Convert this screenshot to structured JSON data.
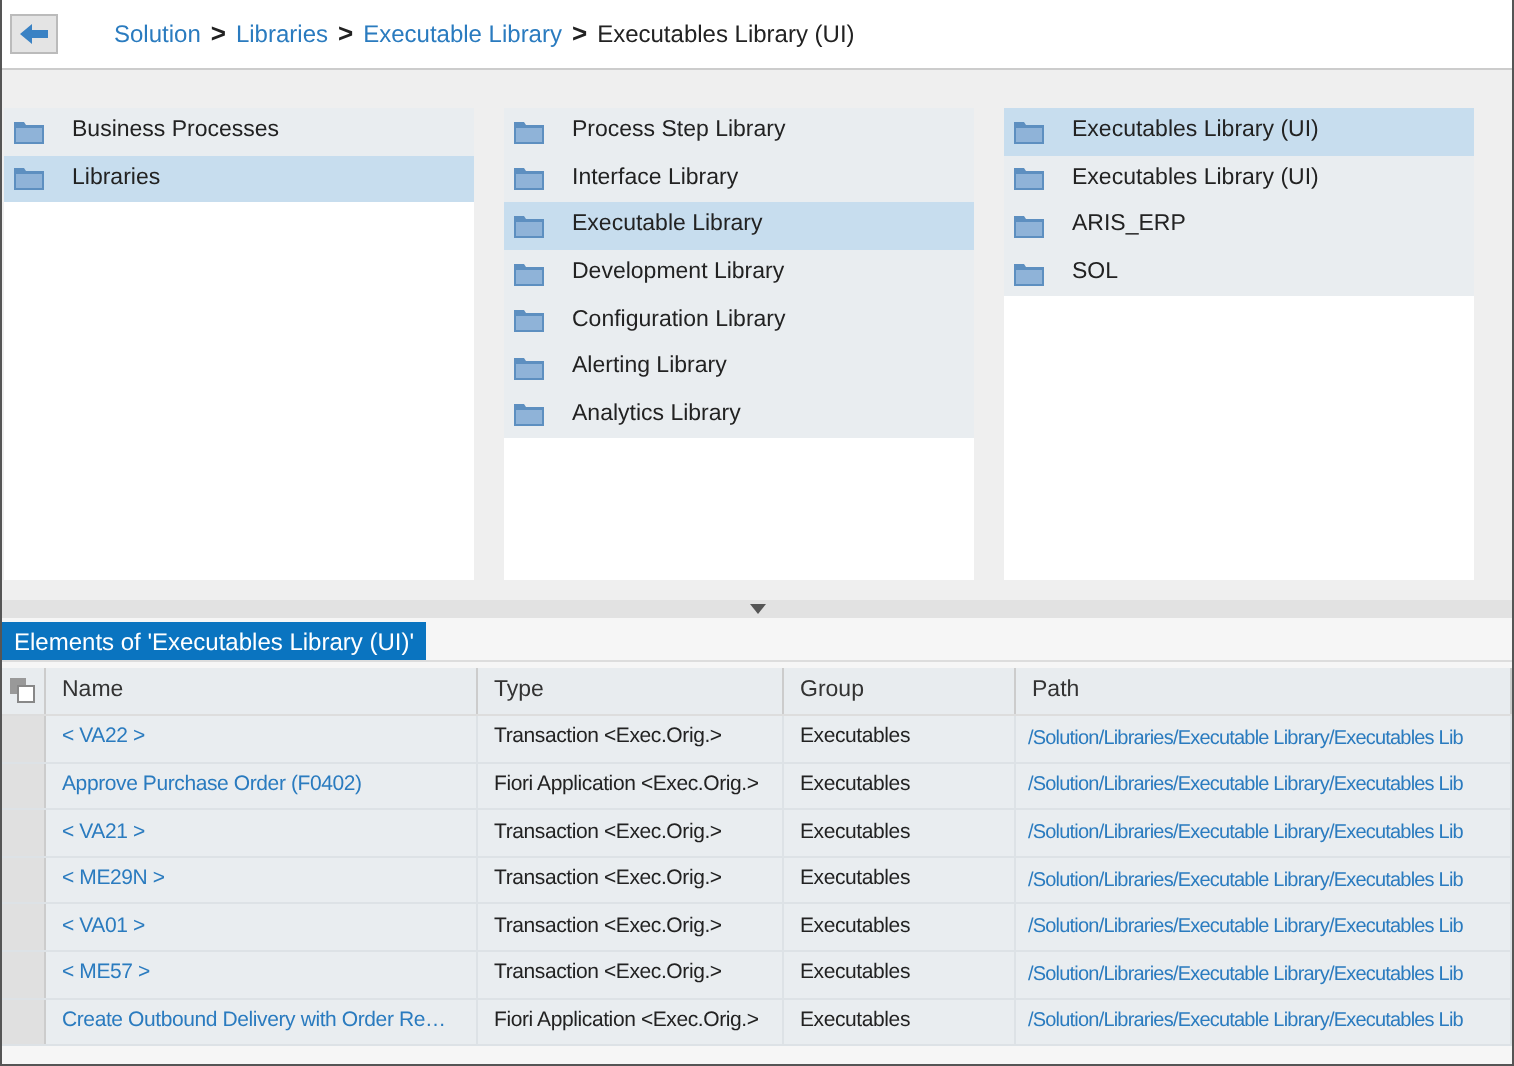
{
  "breadcrumb": [
    {
      "label": "Solution",
      "current": false
    },
    {
      "separator": ">",
      "label": "Libraries",
      "current": false
    },
    {
      "separator": ">",
      "label": "Executable Library",
      "current": false
    },
    {
      "separator": ">",
      "label": "Executables Library (UI)",
      "current": true
    }
  ],
  "panes": [
    {
      "items": [
        {
          "label": "Business Processes",
          "selected": false
        },
        {
          "label": "Libraries",
          "selected": true
        }
      ]
    },
    {
      "items": [
        {
          "label": "Process Step Library",
          "selected": false
        },
        {
          "label": "Interface Library",
          "selected": false
        },
        {
          "label": "Executable Library",
          "selected": true
        },
        {
          "label": "Development Library",
          "selected": false
        },
        {
          "label": "Configuration Library",
          "selected": false
        },
        {
          "label": "Alerting Library",
          "selected": false
        },
        {
          "label": "Analytics Library",
          "selected": false
        }
      ]
    },
    {
      "items": [
        {
          "label": "Executables Library (UI)",
          "selected": true
        },
        {
          "label": "Executables Library (UI)",
          "selected": false
        },
        {
          "label": "ARIS_ERP",
          "selected": false
        },
        {
          "label": "SOL",
          "selected": false
        }
      ]
    }
  ],
  "table": {
    "tab": "Elements of 'Executables Library (UI)'",
    "columns": [
      "Name",
      "Type",
      "Group",
      "Path"
    ],
    "rows": [
      [
        "< VA22 >",
        "Transaction <Exec.Orig.>",
        "Executables",
        "/Solution/Libraries/Executable Library/Executables Lib"
      ],
      [
        "Approve Purchase Order (F0402)",
        "Fiori Application <Exec.Orig.>",
        "Executables",
        "/Solution/Libraries/Executable Library/Executables Lib"
      ],
      [
        "< VA21 >",
        "Transaction <Exec.Orig.>",
        "Executables",
        "/Solution/Libraries/Executable Library/Executables Lib"
      ],
      [
        "< ME29N >",
        "Transaction <Exec.Orig.>",
        "Executables",
        "/Solution/Libraries/Executable Library/Executables Lib"
      ],
      [
        "< VA01 >",
        "Transaction <Exec.Orig.>",
        "Executables",
        "/Solution/Libraries/Executable Library/Executables Lib"
      ],
      [
        "< ME57 >",
        "Transaction <Exec.Orig.>",
        "Executables",
        "/Solution/Libraries/Executable Library/Executables Lib"
      ],
      [
        "Create Outbound Delivery with Order Re…",
        "Fiori Application <Exec.Orig.>",
        "Executables",
        "/Solution/Libraries/Executable Library/Executables Lib"
      ]
    ]
  }
}
